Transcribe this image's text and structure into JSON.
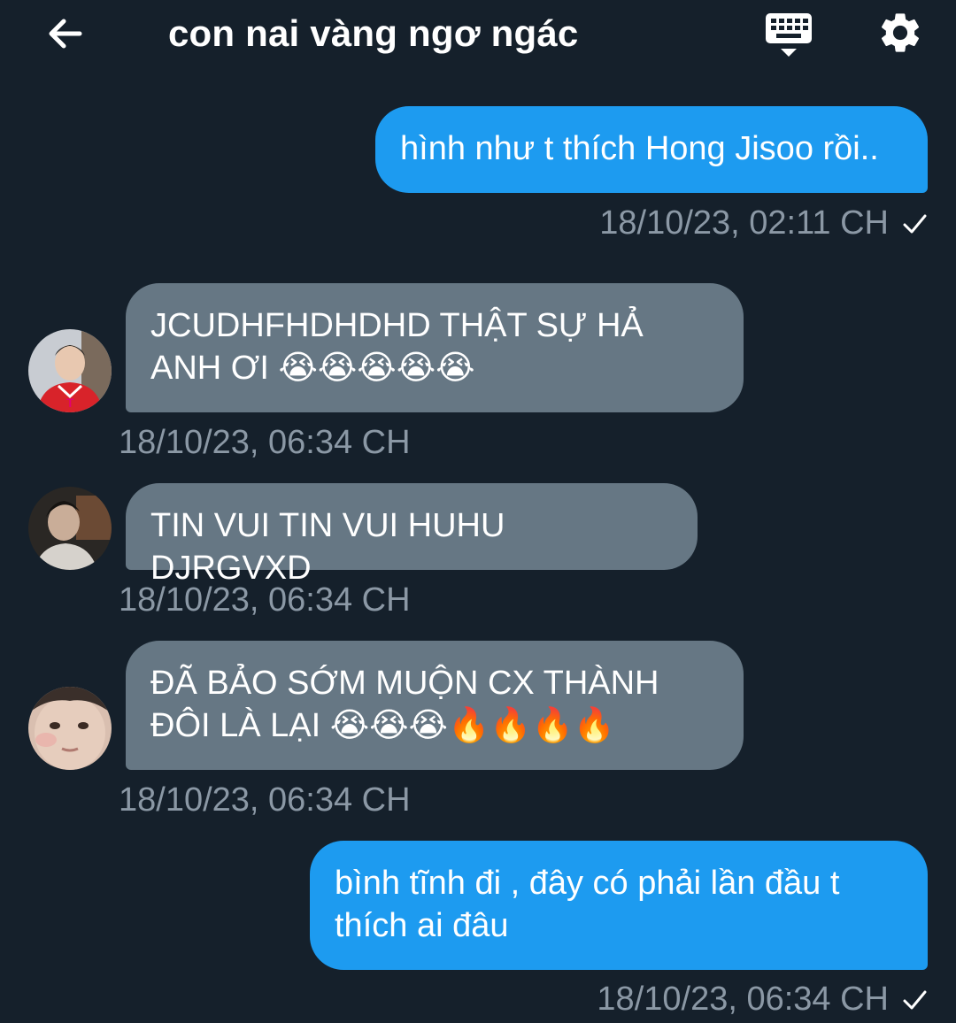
{
  "header": {
    "title": "con nai vàng ngơ ngác",
    "back_icon": "arrow-left-icon",
    "keyboard_icon": "keyboard-icon",
    "settings_icon": "gear-icon"
  },
  "colors": {
    "background": "#15202b",
    "outgoing_bubble": "#1d9bf0",
    "incoming_bubble": "#667784",
    "timestamp": "#8b98a5"
  },
  "messages": [
    {
      "direction": "out",
      "text": "hình như t thích Hong Jisoo rồi..",
      "time": "18/10/23, 02:11 CH",
      "status": "sent"
    },
    {
      "direction": "in",
      "line1": "JCUDHFHDHDHD THẬT SỰ HẢ",
      "line2": "ANH ƠI 😭😭😭😭😭",
      "time": "18/10/23, 06:34 CH",
      "avatar": "avatar-red-shirt"
    },
    {
      "direction": "in",
      "text": "TIN VUI TIN VUI HUHU DJRGVXD",
      "time": "18/10/23, 06:34 CH",
      "avatar": "avatar-dark"
    },
    {
      "direction": "in",
      "line1": "ĐÃ BẢO SỚM MUỘN CX THÀNH",
      "line2": "ĐÔI LÀ LẠI 😭😭😭🔥🔥🔥🔥",
      "time": "18/10/23, 06:34 CH",
      "avatar": "avatar-face"
    },
    {
      "direction": "out",
      "line1": "bình tĩnh đi , đây có phải lần đầu t",
      "line2": "thích ai đâu",
      "time": "18/10/23, 06:34 CH",
      "status": "sent"
    }
  ]
}
